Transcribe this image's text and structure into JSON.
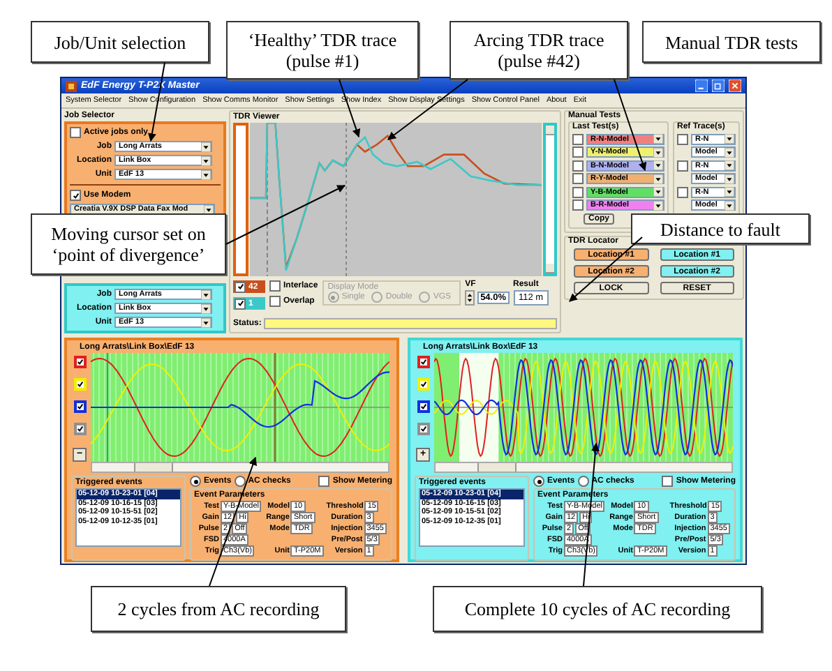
{
  "callouts": [
    {
      "text": "Job/Unit selection"
    },
    {
      "text": "‘Healthy’ TDR trace\n(pulse #1)"
    },
    {
      "text": "Arcing TDR trace\n(pulse #42)"
    },
    {
      "text": "Manual TDR tests"
    },
    {
      "text": "Moving cursor set on\n‘point of divergence’"
    },
    {
      "text": "Distance to fault"
    },
    {
      "text": "2 cycles from AC recording"
    },
    {
      "text": "Complete 10 cycles of AC recording"
    }
  ],
  "window": {
    "title": "EdF Energy T-P2X Master"
  },
  "menu": [
    "System Selector",
    "Show Configuration",
    "Show Comms Monitor",
    "Show Settings",
    "Show Index",
    "Show Display Settings",
    "Show Control Panel",
    "About",
    "Exit"
  ],
  "job_selector": {
    "title": "Job Selector",
    "active_jobs_only": {
      "label": "Active jobs only",
      "checked": false
    },
    "fields": [
      {
        "label": "Job",
        "value": "Long Arrats"
      },
      {
        "label": "Location",
        "value": "Link Box"
      },
      {
        "label": "Unit",
        "value": "EdF 13"
      }
    ],
    "use_modem": {
      "label": "Use Modem",
      "checked": true
    },
    "modem": "Creatia V.9X DSP Data Fax Mod"
  },
  "second_selector": {
    "fields": [
      {
        "label": "Job",
        "value": "Long Arrats"
      },
      {
        "label": "Location",
        "value": "Link Box"
      },
      {
        "label": "Unit",
        "value": "EdF 13"
      }
    ]
  },
  "tdr_viewer": {
    "title": "TDR Viewer",
    "traces": [
      {
        "label": "42",
        "checked": true,
        "color": "#c8501e"
      },
      {
        "label": "1",
        "checked": true,
        "color": "#3cc8c8"
      }
    ],
    "interlace": {
      "label": "Interlace",
      "checked": false
    },
    "overlap": {
      "label": "Overlap",
      "checked": false
    },
    "display_mode": {
      "title": "Display Mode",
      "disabled": true,
      "options": [
        {
          "label": "Single",
          "selected": true
        },
        {
          "label": "Double",
          "selected": false
        },
        {
          "label": "VGS",
          "selected": false
        }
      ]
    },
    "vf": {
      "label": "VF",
      "value": "54.0%"
    },
    "result": {
      "label": "Result",
      "value": "112 m"
    },
    "status": {
      "label": "Status:"
    }
  },
  "manual_tests": {
    "title": "Manual Tests",
    "last_title": "Last Test(s)",
    "ref_title": "Ref Trace(s)",
    "last": [
      {
        "checked": false,
        "value": "R-N-Model",
        "color": "#f08080"
      },
      {
        "checked": false,
        "value": "Y-N-Model",
        "color": "#f0f070"
      },
      {
        "checked": false,
        "value": "B-N-Model",
        "color": "#b0b0f0"
      },
      {
        "checked": false,
        "value": "R-Y-Model",
        "color": "#f0b070"
      },
      {
        "checked": false,
        "value": "Y-B-Model",
        "color": "#60e060"
      },
      {
        "checked": false,
        "value": "B-R-Model",
        "color": "#f080f0"
      }
    ],
    "ref": [
      {
        "kind": "check",
        "checked": false,
        "value": "R-N"
      },
      {
        "kind": "plain",
        "value": "Model"
      },
      {
        "kind": "check",
        "checked": false,
        "value": "R-N"
      },
      {
        "kind": "plain",
        "value": "Model"
      },
      {
        "kind": "check",
        "checked": false,
        "value": "R-N"
      },
      {
        "kind": "plain",
        "value": "Model"
      }
    ],
    "copy": "Copy"
  },
  "tdr_locator": {
    "title": "TDR Locator",
    "buttons": [
      {
        "label": "Location #1",
        "color": "#f8b070"
      },
      {
        "label": "Location #1",
        "color": "#80f0f0"
      },
      {
        "label": "Location #2",
        "color": "#f8b070"
      },
      {
        "label": "Location #2",
        "color": "#80f0f0"
      },
      {
        "label": "LOCK",
        "color": "#ece9d8"
      },
      {
        "label": "RESET",
        "color": "#ece9d8"
      }
    ]
  },
  "panels": [
    {
      "kind": "orange",
      "path": "Long Arrats\\Link Box\\EdF 13",
      "zoom": "−",
      "channels": [
        {
          "color": "#e02020",
          "checked": true
        },
        {
          "color": "#f0f000",
          "checked": true
        },
        {
          "color": "#1030e0",
          "checked": true
        },
        {
          "color": "#909090",
          "checked": true
        }
      ],
      "events_title": "Triggered events",
      "events": [
        {
          "text": "05-12-09 10-23-01 [04]",
          "selected": true
        },
        {
          "text": "05-12-09 10-16-15 [03]",
          "selected": false
        },
        {
          "text": "05-12-09 10-15-51 [02]",
          "selected": false
        },
        {
          "text": "05-12-09 10-12-35 [01]",
          "selected": false
        }
      ],
      "modes": [
        {
          "label": "Events",
          "selected": true
        },
        {
          "label": "AC checks",
          "selected": false
        }
      ],
      "show_metering": {
        "label": "Show Metering",
        "checked": false
      },
      "params_title": "Event Parameters",
      "params": [
        [
          {
            "label": "Test",
            "values": [
              "Y-B-Model"
            ]
          },
          {
            "label": "Gain",
            "values": [
              "12",
              "Hi"
            ]
          },
          {
            "label": "Pulse",
            "values": [
              "2",
              "Off"
            ]
          },
          {
            "label": "FSD",
            "values": [
              "4000A"
            ]
          },
          {
            "label": "Trig",
            "values": [
              "Ch3(Vb)"
            ]
          }
        ],
        [
          {
            "label": "Model",
            "values": [
              "10"
            ]
          },
          {
            "label": "Range",
            "values": [
              "Short"
            ]
          },
          {
            "label": "Mode",
            "values": [
              "TDR"
            ]
          },
          {
            "label": "Unit",
            "values": [
              "T-P20M"
            ]
          }
        ],
        [
          {
            "label": "Threshold",
            "values": [
              "15"
            ]
          },
          {
            "label": "Duration",
            "values": [
              "3"
            ]
          },
          {
            "label": "Injection",
            "values": [
              "3455"
            ]
          },
          {
            "label": "Pre/Post",
            "values": [
              "5/3"
            ]
          },
          {
            "label": "Version",
            "values": [
              "1"
            ]
          }
        ]
      ]
    },
    {
      "kind": "cyan",
      "path": "Long Arrats\\Link Box\\EdF 13",
      "zoom": "+",
      "channels": [
        {
          "color": "#e02020",
          "checked": true
        },
        {
          "color": "#f0f000",
          "checked": true
        },
        {
          "color": "#1030e0",
          "checked": true
        },
        {
          "color": "#909090",
          "checked": true
        }
      ],
      "events_title": "Triggered events",
      "events": [
        {
          "text": "05-12-09 10-23-01 [04]",
          "selected": true
        },
        {
          "text": "05-12-09 10-16-15 [03]",
          "selected": false
        },
        {
          "text": "05-12-09 10-15-51 [02]",
          "selected": false
        },
        {
          "text": "05-12-09 10-12-35 [01]",
          "selected": false
        }
      ],
      "modes": [
        {
          "label": "Events",
          "selected": true
        },
        {
          "label": "AC checks",
          "selected": false
        }
      ],
      "show_metering": {
        "label": "Show Metering",
        "checked": false
      },
      "params_title": "Event Parameters",
      "params": [
        [
          {
            "label": "Test",
            "values": [
              "Y-B-Model"
            ]
          },
          {
            "label": "Gain",
            "values": [
              "12",
              "Hi"
            ]
          },
          {
            "label": "Pulse",
            "values": [
              "2",
              "Off"
            ]
          },
          {
            "label": "FSD",
            "values": [
              "4000A"
            ]
          },
          {
            "label": "Trig",
            "values": [
              "Ch3(Vb)"
            ]
          }
        ],
        [
          {
            "label": "Model",
            "values": [
              "10"
            ]
          },
          {
            "label": "Range",
            "values": [
              "Short"
            ]
          },
          {
            "label": "Mode",
            "values": [
              "TDR"
            ]
          },
          {
            "label": "Unit",
            "values": [
              "T-P20M"
            ]
          }
        ],
        [
          {
            "label": "Threshold",
            "values": [
              "15"
            ]
          },
          {
            "label": "Duration",
            "values": [
              "3"
            ]
          },
          {
            "label": "Injection",
            "values": [
              "3455"
            ]
          },
          {
            "label": "Pre/Post",
            "values": [
              "5/3"
            ]
          },
          {
            "label": "Version",
            "values": [
              "1"
            ]
          }
        ]
      ]
    }
  ]
}
